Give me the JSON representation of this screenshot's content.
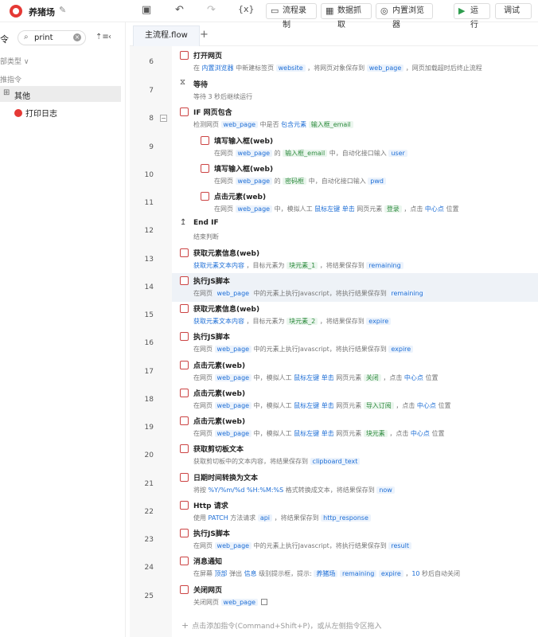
{
  "app": {
    "title": "养猪场"
  },
  "toolbar": {
    "record_label": "流程录制",
    "extract_label": "数据抓取",
    "browser_label": "内置浏览器",
    "run_label": "运行",
    "debug_label": "调试"
  },
  "sidebar": {
    "cut_label": "令",
    "search_value": "print",
    "filter_label": "部类型 ∨",
    "section_label": "推指令",
    "group_label": "其他",
    "item_label": "打印日志"
  },
  "tab": {
    "label": "主流程.flow"
  },
  "flow": [
    {
      "no": "6",
      "title": "打开网页",
      "desc": [
        [
          "t",
          "在 "
        ],
        [
          "k",
          "内置浏览器"
        ],
        [
          "t",
          " 中新建标签页 "
        ],
        [
          "v",
          "website"
        ],
        [
          "t",
          " ，将网页对象保存到 "
        ],
        [
          "v",
          "web_page"
        ],
        [
          "t",
          " ，网页加载超时后终止流程"
        ]
      ]
    },
    {
      "no": "7",
      "title": "等待",
      "desc": [
        [
          "t",
          "等待 3 秒后继续运行"
        ]
      ]
    },
    {
      "no": "8",
      "title": "IF 网页包含",
      "desc": [
        [
          "t",
          "检测网页 "
        ],
        [
          "v",
          "web_page"
        ],
        [
          "t",
          " 中是否 "
        ],
        [
          "k",
          "包含元素"
        ],
        [
          "t",
          "  "
        ],
        [
          "g",
          "输入框_email"
        ]
      ]
    },
    {
      "no": "9",
      "title": "填写输入框(web)",
      "desc": [
        [
          "t",
          "在网页 "
        ],
        [
          "v",
          "web_page"
        ],
        [
          "t",
          " 的 "
        ],
        [
          "g",
          "输入框_email"
        ],
        [
          "t",
          " 中，自动化接口输入 "
        ],
        [
          "v",
          "user"
        ]
      ]
    },
    {
      "no": "10",
      "title": "填写输入框(web)",
      "desc": [
        [
          "t",
          "在网页 "
        ],
        [
          "v",
          "web_page"
        ],
        [
          "t",
          " 的 "
        ],
        [
          "g",
          "密码框"
        ],
        [
          "t",
          " 中，自动化接口输入 "
        ],
        [
          "v",
          "pwd"
        ]
      ]
    },
    {
      "no": "11",
      "title": "点击元素(web)",
      "desc": [
        [
          "t",
          "在网页 "
        ],
        [
          "v",
          "web_page"
        ],
        [
          "t",
          " 中，模拟人工 "
        ],
        [
          "k",
          "鼠标左键 单击"
        ],
        [
          "t",
          " 网页元素 "
        ],
        [
          "g",
          "登录"
        ],
        [
          "t",
          " ，点击 "
        ],
        [
          "k",
          "中心点"
        ],
        [
          "t",
          " 位置"
        ]
      ]
    },
    {
      "no": "12",
      "title": "End IF",
      "desc": [
        [
          "t",
          "结束判断"
        ]
      ]
    },
    {
      "no": "13",
      "title": "获取元素信息(web)",
      "desc": [
        [
          "k",
          "获取元素文本内容"
        ],
        [
          "t",
          " ，目标元素为 "
        ],
        [
          "g",
          "块元素_1"
        ],
        [
          "t",
          " ，将结果保存到 "
        ],
        [
          "v",
          "remaining"
        ]
      ]
    },
    {
      "no": "14",
      "title": "执行JS脚本",
      "desc": [
        [
          "t",
          "在网页 "
        ],
        [
          "v",
          "web_page"
        ],
        [
          "t",
          " 中的元素上执行Javascript，将执行结果保存到 "
        ],
        [
          "v",
          "remaining"
        ]
      ]
    },
    {
      "no": "15",
      "title": "获取元素信息(web)",
      "desc": [
        [
          "k",
          "获取元素文本内容"
        ],
        [
          "t",
          " ，目标元素为 "
        ],
        [
          "g",
          "块元素_2"
        ],
        [
          "t",
          " ，将结果保存到 "
        ],
        [
          "v",
          "expire"
        ]
      ]
    },
    {
      "no": "16",
      "title": "执行JS脚本",
      "desc": [
        [
          "t",
          "在网页 "
        ],
        [
          "v",
          "web_page"
        ],
        [
          "t",
          " 中的元素上执行Javascript，将执行结果保存到 "
        ],
        [
          "v",
          "expire"
        ]
      ]
    },
    {
      "no": "17",
      "title": "点击元素(web)",
      "desc": [
        [
          "t",
          "在网页 "
        ],
        [
          "v",
          "web_page"
        ],
        [
          "t",
          " 中，模拟人工 "
        ],
        [
          "k",
          "鼠标左键 单击"
        ],
        [
          "t",
          " 网页元素 "
        ],
        [
          "g",
          "关闭"
        ],
        [
          "t",
          " ，点击 "
        ],
        [
          "k",
          "中心点"
        ],
        [
          "t",
          " 位置"
        ]
      ]
    },
    {
      "no": "18",
      "title": "点击元素(web)",
      "desc": [
        [
          "t",
          "在网页 "
        ],
        [
          "v",
          "web_page"
        ],
        [
          "t",
          " 中，模拟人工 "
        ],
        [
          "k",
          "鼠标左键 单击"
        ],
        [
          "t",
          " 网页元素 "
        ],
        [
          "g",
          "导入订阅"
        ],
        [
          "t",
          " ，点击 "
        ],
        [
          "k",
          "中心点"
        ],
        [
          "t",
          " 位置"
        ]
      ]
    },
    {
      "no": "19",
      "title": "点击元素(web)",
      "desc": [
        [
          "t",
          "在网页 "
        ],
        [
          "v",
          "web_page"
        ],
        [
          "t",
          " 中，模拟人工 "
        ],
        [
          "k",
          "鼠标左键 单击"
        ],
        [
          "t",
          " 网页元素 "
        ],
        [
          "g",
          "块元素"
        ],
        [
          "t",
          " ，点击 "
        ],
        [
          "k",
          "中心点"
        ],
        [
          "t",
          " 位置"
        ]
      ]
    },
    {
      "no": "20",
      "title": "获取剪切板文本",
      "desc": [
        [
          "t",
          "获取剪切板中的文本内容，将结果保存到 "
        ],
        [
          "v",
          "clipboard_text"
        ]
      ]
    },
    {
      "no": "21",
      "title": "日期时间转换为文本",
      "desc": [
        [
          "t",
          "将按 "
        ],
        [
          "k",
          "%Y/%m/%d %H:%M:%S"
        ],
        [
          "t",
          " 格式转换成文本，将结果保存到 "
        ],
        [
          "v",
          "now"
        ]
      ]
    },
    {
      "no": "22",
      "title": "Http 请求",
      "desc": [
        [
          "t",
          "使用 "
        ],
        [
          "k",
          "PATCH"
        ],
        [
          "t",
          " 方法请求 "
        ],
        [
          "v",
          "api"
        ],
        [
          "t",
          " ，将结果保存到 "
        ],
        [
          "v",
          "http_response"
        ]
      ]
    },
    {
      "no": "23",
      "title": "执行JS脚本",
      "desc": [
        [
          "t",
          "在网页 "
        ],
        [
          "v",
          "web_page"
        ],
        [
          "t",
          " 中的元素上执行Javascript，将执行结果保存到 "
        ],
        [
          "v",
          "result"
        ]
      ]
    },
    {
      "no": "24",
      "title": "消息通知",
      "desc": [
        [
          "t",
          "在屏幕 "
        ],
        [
          "k",
          "顶部"
        ],
        [
          "t",
          " 弹出 "
        ],
        [
          "k",
          "信息"
        ],
        [
          "t",
          " 级别提示框，提示: "
        ],
        [
          "v",
          "养猪场"
        ],
        [
          "t",
          "  "
        ],
        [
          "v",
          "remaining"
        ],
        [
          "t",
          "  "
        ],
        [
          "v",
          "expire"
        ],
        [
          "t",
          " ，"
        ],
        [
          "k",
          "10"
        ],
        [
          "t",
          " 秒后自动关闭"
        ]
      ]
    },
    {
      "no": "25",
      "title": "关闭网页",
      "desc": [
        [
          "t",
          "关闭网页 "
        ],
        [
          "v",
          "web_page"
        ]
      ]
    }
  ],
  "add_hint": "点击添加指令(Command+Shift+P)，或从左侧指令区拖入"
}
